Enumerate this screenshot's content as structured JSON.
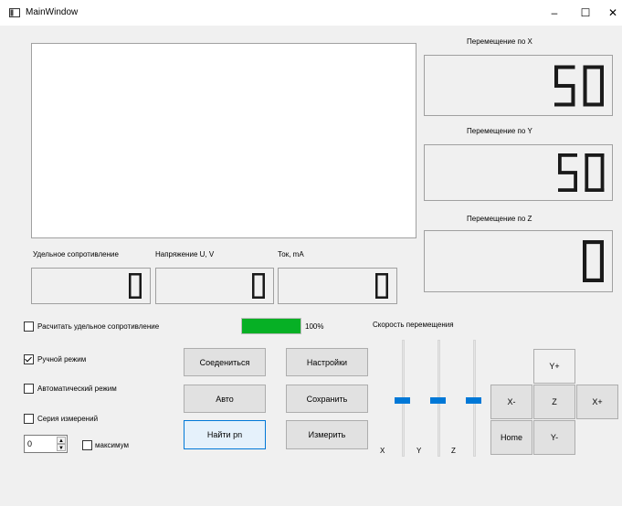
{
  "window": {
    "title": "MainWindow",
    "minimize": "–",
    "maximize": "☐",
    "close": "✕"
  },
  "displays": {
    "move_x": {
      "label": "Перемещение по X",
      "value": "50"
    },
    "move_y": {
      "label": "Перемещение по Y",
      "value": "50"
    },
    "move_z": {
      "label": "Перемещение по Z",
      "value": "0"
    },
    "resistivity": {
      "label": "Удельное сопротивление",
      "value": "0"
    },
    "voltage": {
      "label": "Напряжение U, V",
      "value": "0"
    },
    "current": {
      "label": "Ток, mA",
      "value": "0"
    }
  },
  "checkboxes": {
    "calc_resistivity": {
      "label": "Расчитать удельное сопротивление",
      "checked": false
    },
    "manual_mode": {
      "label": "Ручной режим",
      "checked": true
    },
    "auto_mode": {
      "label": "Автоматический режим",
      "checked": false
    },
    "series": {
      "label": "Серия измерений",
      "checked": false
    },
    "maximum": {
      "label": "максимум",
      "checked": false
    }
  },
  "progress": {
    "value": 100,
    "text": "100%",
    "color": "#06b025"
  },
  "spinbox": {
    "value": "0",
    "up": "▲",
    "down": "▼"
  },
  "buttons": {
    "connect": "Соедениться",
    "settings": "Настройки",
    "auto": "Авто",
    "save": "Сохранить",
    "find_pn": "Найти pn",
    "measure": "Измерить"
  },
  "speed": {
    "label": "Скорость перемещения",
    "sliders": [
      {
        "axis": "X",
        "value": 0.5
      },
      {
        "axis": "Y",
        "value": 0.5
      },
      {
        "axis": "Z",
        "value": 0.5
      }
    ]
  },
  "jog": {
    "y_plus": "Y+",
    "x_minus": "X-",
    "z": "Z",
    "x_plus": "X+",
    "home": "Home",
    "y_minus": "Y-"
  }
}
